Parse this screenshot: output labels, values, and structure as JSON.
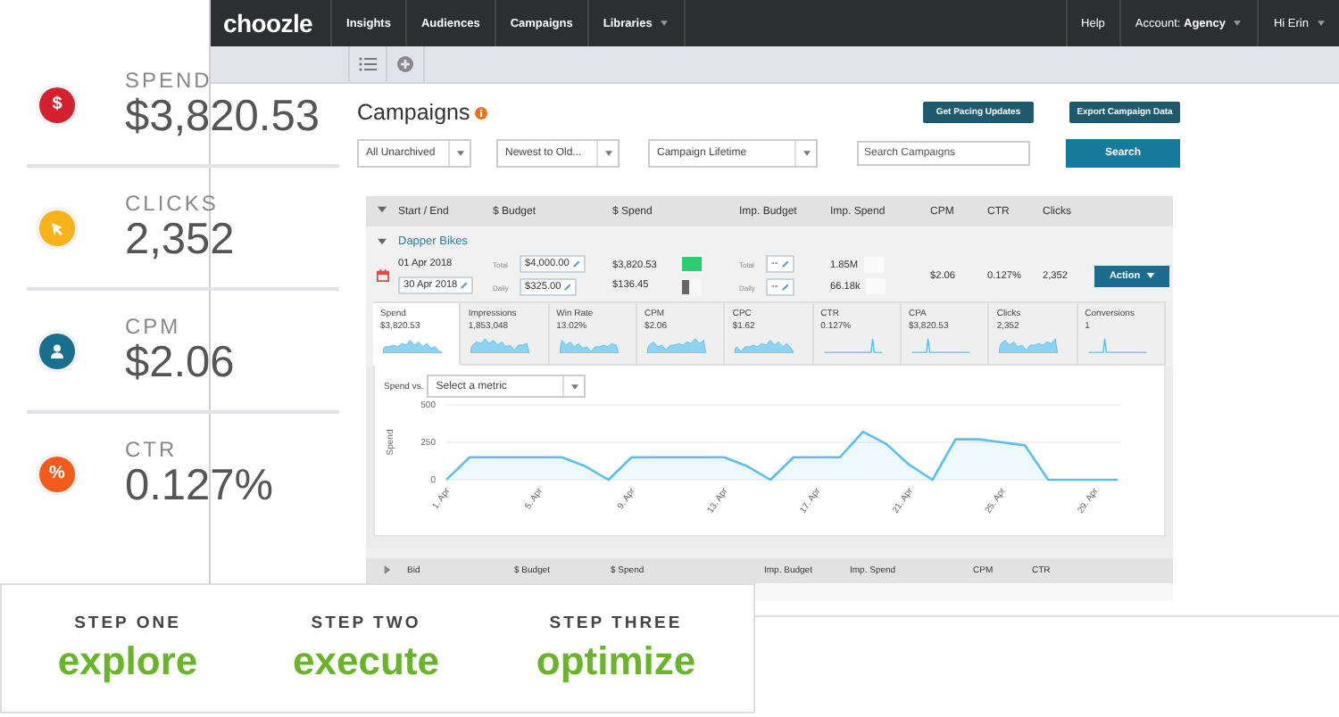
{
  "metrics_panel": [
    {
      "label": "SPEND",
      "value": "$3,820.53",
      "kind": "glyph",
      "glyph": "$",
      "color": "#d4212f"
    },
    {
      "label": "CLICKS",
      "value": "2,352",
      "kind": "pointer",
      "color": "#f7b219"
    },
    {
      "label": "CPM",
      "value": "$2.06",
      "kind": "person",
      "color": "#186f8e"
    },
    {
      "label": "CTR",
      "value": "0.127%",
      "kind": "glyph",
      "glyph": "%",
      "color": "#f35b1c"
    }
  ],
  "app": {
    "logo": "choozle",
    "nav": [
      {
        "label": "Insights",
        "dropdown": false
      },
      {
        "label": "Audiences",
        "dropdown": false
      },
      {
        "label": "Campaigns",
        "dropdown": false
      },
      {
        "label": "Libraries",
        "dropdown": true
      }
    ],
    "nav_right": [
      {
        "label": "Help",
        "dropdown": false
      },
      {
        "label": "Account: **Agency**",
        "dropdown": true
      },
      {
        "label": "Hi Erin",
        "dropdown": true
      }
    ]
  },
  "page": {
    "title": "Campaigns",
    "buttons": [
      "Get Pacing Updates",
      "Export Campaign Data"
    ],
    "filters": [
      {
        "kind": "select",
        "value": "All Unarchived"
      },
      {
        "kind": "select",
        "value": "Newest to Old..."
      },
      {
        "kind": "select",
        "value": "Campaign Lifetime"
      },
      {
        "kind": "search",
        "placeholder": "Search Campaigns"
      }
    ],
    "search_button": "Search"
  },
  "campaign_table": {
    "header": {
      "expanded": true,
      "columns": [
        "Start / End",
        "$ Budget",
        "$ Spend",
        "Imp. Budget",
        "Imp. Spend",
        "CPM",
        "CTR",
        "Clicks"
      ]
    },
    "campaigns": [
      {
        "name": "Dapper Bikes",
        "expanded": true,
        "start": "01 Apr 2018",
        "end": "30 Apr 2018",
        "budget": [
          {
            "label": "Total",
            "value": "$4,000.00"
          },
          {
            "label": "Daily",
            "value": "$325.00"
          }
        ],
        "spend": [
          {
            "value": "$3,820.53",
            "level": 1,
            "color": "#2ecc71"
          },
          {
            "value": "$136.45",
            "level": 0.4,
            "color": "#666666"
          }
        ],
        "imp_budget": [
          {
            "label": "Total",
            "value": "--"
          },
          {
            "label": "Daily",
            "value": "--"
          }
        ],
        "imp_spend": [
          "1.85M",
          "66.18k"
        ],
        "cpm": "$2.06",
        "ctr": "0.127%",
        "clicks": "2,352",
        "action": "Action"
      }
    ],
    "metric_tabs": [
      {
        "label": "Spend",
        "value": "$3,820.53",
        "selected": true,
        "kind": "wave"
      },
      {
        "label": "Impressions",
        "value": "1,853,048",
        "selected": false,
        "kind": "wave"
      },
      {
        "label": "Win Rate",
        "value": "13.02%",
        "selected": false,
        "kind": "wave"
      },
      {
        "label": "CPM",
        "value": "$2.06",
        "selected": false,
        "kind": "wave"
      },
      {
        "label": "CPC",
        "value": "$1.62",
        "selected": false,
        "kind": "wave"
      },
      {
        "label": "CTR",
        "value": "0.127%",
        "selected": false,
        "kind": "spike"
      },
      {
        "label": "CPA",
        "value": "$3,820.53",
        "selected": false,
        "kind": "spike"
      },
      {
        "label": "Clicks",
        "value": "2,352",
        "selected": false,
        "kind": "wave"
      },
      {
        "label": "Conversions",
        "value": "1",
        "selected": false,
        "kind": "spike"
      }
    ],
    "chart": {
      "compare_label": "Spend vs.",
      "compare_placeholder": "Select a metric",
      "chart_data": {
        "type": "area",
        "ylabel": "Spend",
        "categories": [
          "1. Apr",
          null,
          null,
          null,
          "5. Apr",
          null,
          null,
          null,
          "9. Apr",
          null,
          null,
          null,
          "13. Apr",
          null,
          null,
          null,
          "17. Apr",
          null,
          null,
          null,
          "21. Apr",
          null,
          null,
          null,
          "25. Apr",
          null,
          null,
          null,
          "29. Apr",
          null
        ],
        "series": [
          {
            "color": "#5bc0eb",
            "values": [
              0,
              150,
              150,
              150,
              150,
              150,
              90,
              0,
              150,
              150,
              150,
              150,
              150,
              90,
              0,
              150,
              150,
              150,
              320,
              240,
              100,
              0,
              270,
              270,
              250,
              230,
              0,
              0,
              0,
              0
            ]
          }
        ],
        "ylim": [
          0,
          500
        ],
        "yticks": [
          0,
          250,
          500
        ]
      }
    },
    "bid_header": {
      "expanded": false,
      "columns": [
        "Bid",
        "$ Budget",
        "$ Spend",
        "Imp. Budget",
        "Imp. Spend",
        "CPM",
        "CTR"
      ]
    }
  },
  "steps": [
    {
      "label": "STEP ONE",
      "word": "explore"
    },
    {
      "label": "STEP TWO",
      "word": "execute"
    },
    {
      "label": "STEP THREE",
      "word": "optimize"
    }
  ]
}
